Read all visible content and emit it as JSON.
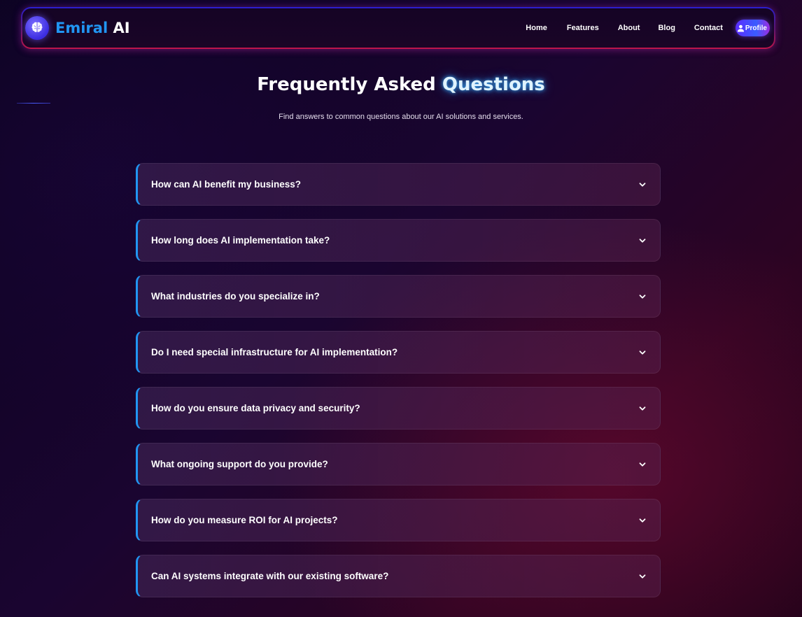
{
  "brand": {
    "name_accent": "Emiral",
    "name_rest": "AI",
    "logo_icon": "brain-icon"
  },
  "nav": {
    "items": [
      {
        "label": "Home"
      },
      {
        "label": "Features"
      },
      {
        "label": "About"
      },
      {
        "label": "Blog"
      },
      {
        "label": "Contact"
      }
    ],
    "profile": {
      "label": "Profile",
      "icon": "user-icon"
    }
  },
  "header": {
    "title_main": "Frequently Asked",
    "title_accent": "Questions",
    "subtitle": "Find answers to common questions about our AI solutions and services."
  },
  "faq": {
    "items": [
      {
        "question": "How can AI benefit my business?"
      },
      {
        "question": "How long does AI implementation take?"
      },
      {
        "question": "What industries do you specialize in?"
      },
      {
        "question": "Do I need special infrastructure for AI implementation?"
      },
      {
        "question": "How do you ensure data privacy and security?"
      },
      {
        "question": "What ongoing support do you provide?"
      },
      {
        "question": "How do you measure ROI for AI projects?"
      },
      {
        "question": "Can AI systems integrate with our existing software?"
      }
    ],
    "expand_icon": "chevron-down-icon"
  },
  "colors": {
    "accent_blue": "#2196f3",
    "title_glow": "#3cb4ff",
    "profile_gradient_start": "#5b2cff",
    "profile_gradient_end": "#9b2be0",
    "nav_border_top": "#2a1fd0",
    "nav_border_bottom": "#c0154a"
  }
}
